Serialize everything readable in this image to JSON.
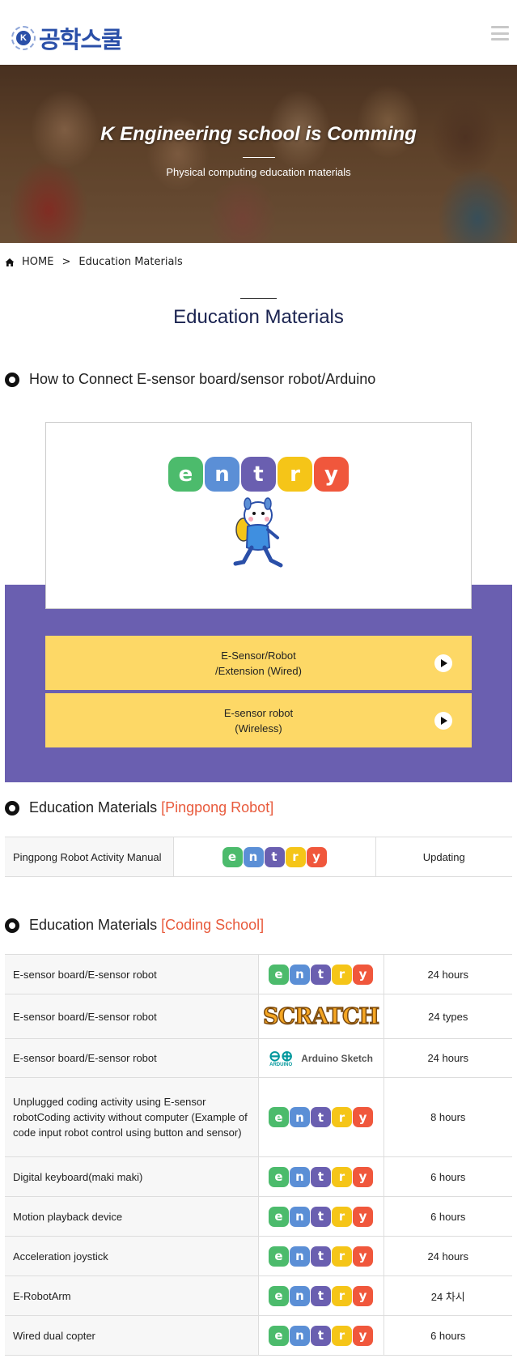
{
  "header": {
    "logo_badge": "K",
    "logo_text": "공학스쿨",
    "menu_icon": "hamburger-icon"
  },
  "hero": {
    "title": "K Engineering school is Comming",
    "subtitle": "Physical computing education materials"
  },
  "breadcrumb": {
    "home": "HOME",
    "separator": ">",
    "current": "Education Materials"
  },
  "page_title": "Education Materials",
  "section1": {
    "heading": "How to Connect E-sensor board/sensor robot/Arduino",
    "buttons": [
      {
        "line1": "E-Sensor/Robot",
        "line2": "/Extension (Wired)"
      },
      {
        "line1": "E-sensor robot",
        "line2": "(Wireless)"
      }
    ]
  },
  "entry_letters": [
    "e",
    "n",
    "t",
    "r",
    "y"
  ],
  "entry_colors": [
    "#4cbb6c",
    "#5b8fd6",
    "#6a5fb0",
    "#f5c518",
    "#f0573c"
  ],
  "section2": {
    "heading": "Education Materials",
    "accent": "[Pingpong Robot]",
    "row": {
      "name": "Pingpong Robot Activity Manual",
      "status": "Updating"
    }
  },
  "section3": {
    "heading": "Education Materials",
    "accent": "[Coding School]",
    "rows": [
      {
        "name": "E-sensor board/E-sensor robot",
        "logo": "entry",
        "value": "24 hours"
      },
      {
        "name": "E-sensor board/E-sensor robot",
        "logo": "scratch",
        "value": "24 types"
      },
      {
        "name": "E-sensor board/E-sensor robot",
        "logo": "arduino",
        "value": "24 hours"
      },
      {
        "name": "Unplugged coding activity using E-sensor robotCoding activity without computer (Example of code input robot control using button and sensor)",
        "logo": "entry",
        "value": "8 hours"
      },
      {
        "name": "Digital keyboard(maki maki)",
        "logo": "entry",
        "value": "6 hours"
      },
      {
        "name": "Motion playback device",
        "logo": "entry",
        "value": "6 hours"
      },
      {
        "name": "Acceleration joystick",
        "logo": "entry",
        "value": "24 hours"
      },
      {
        "name": "E-RobotArm",
        "logo": "entry",
        "value": "24 차시"
      },
      {
        "name": "Wired dual copter",
        "logo": "entry",
        "value": "6 hours"
      }
    ],
    "scratch_text": "SCRATCH",
    "arduino_label": "ARDUINO",
    "arduino_text": "Arduino Sketch"
  }
}
